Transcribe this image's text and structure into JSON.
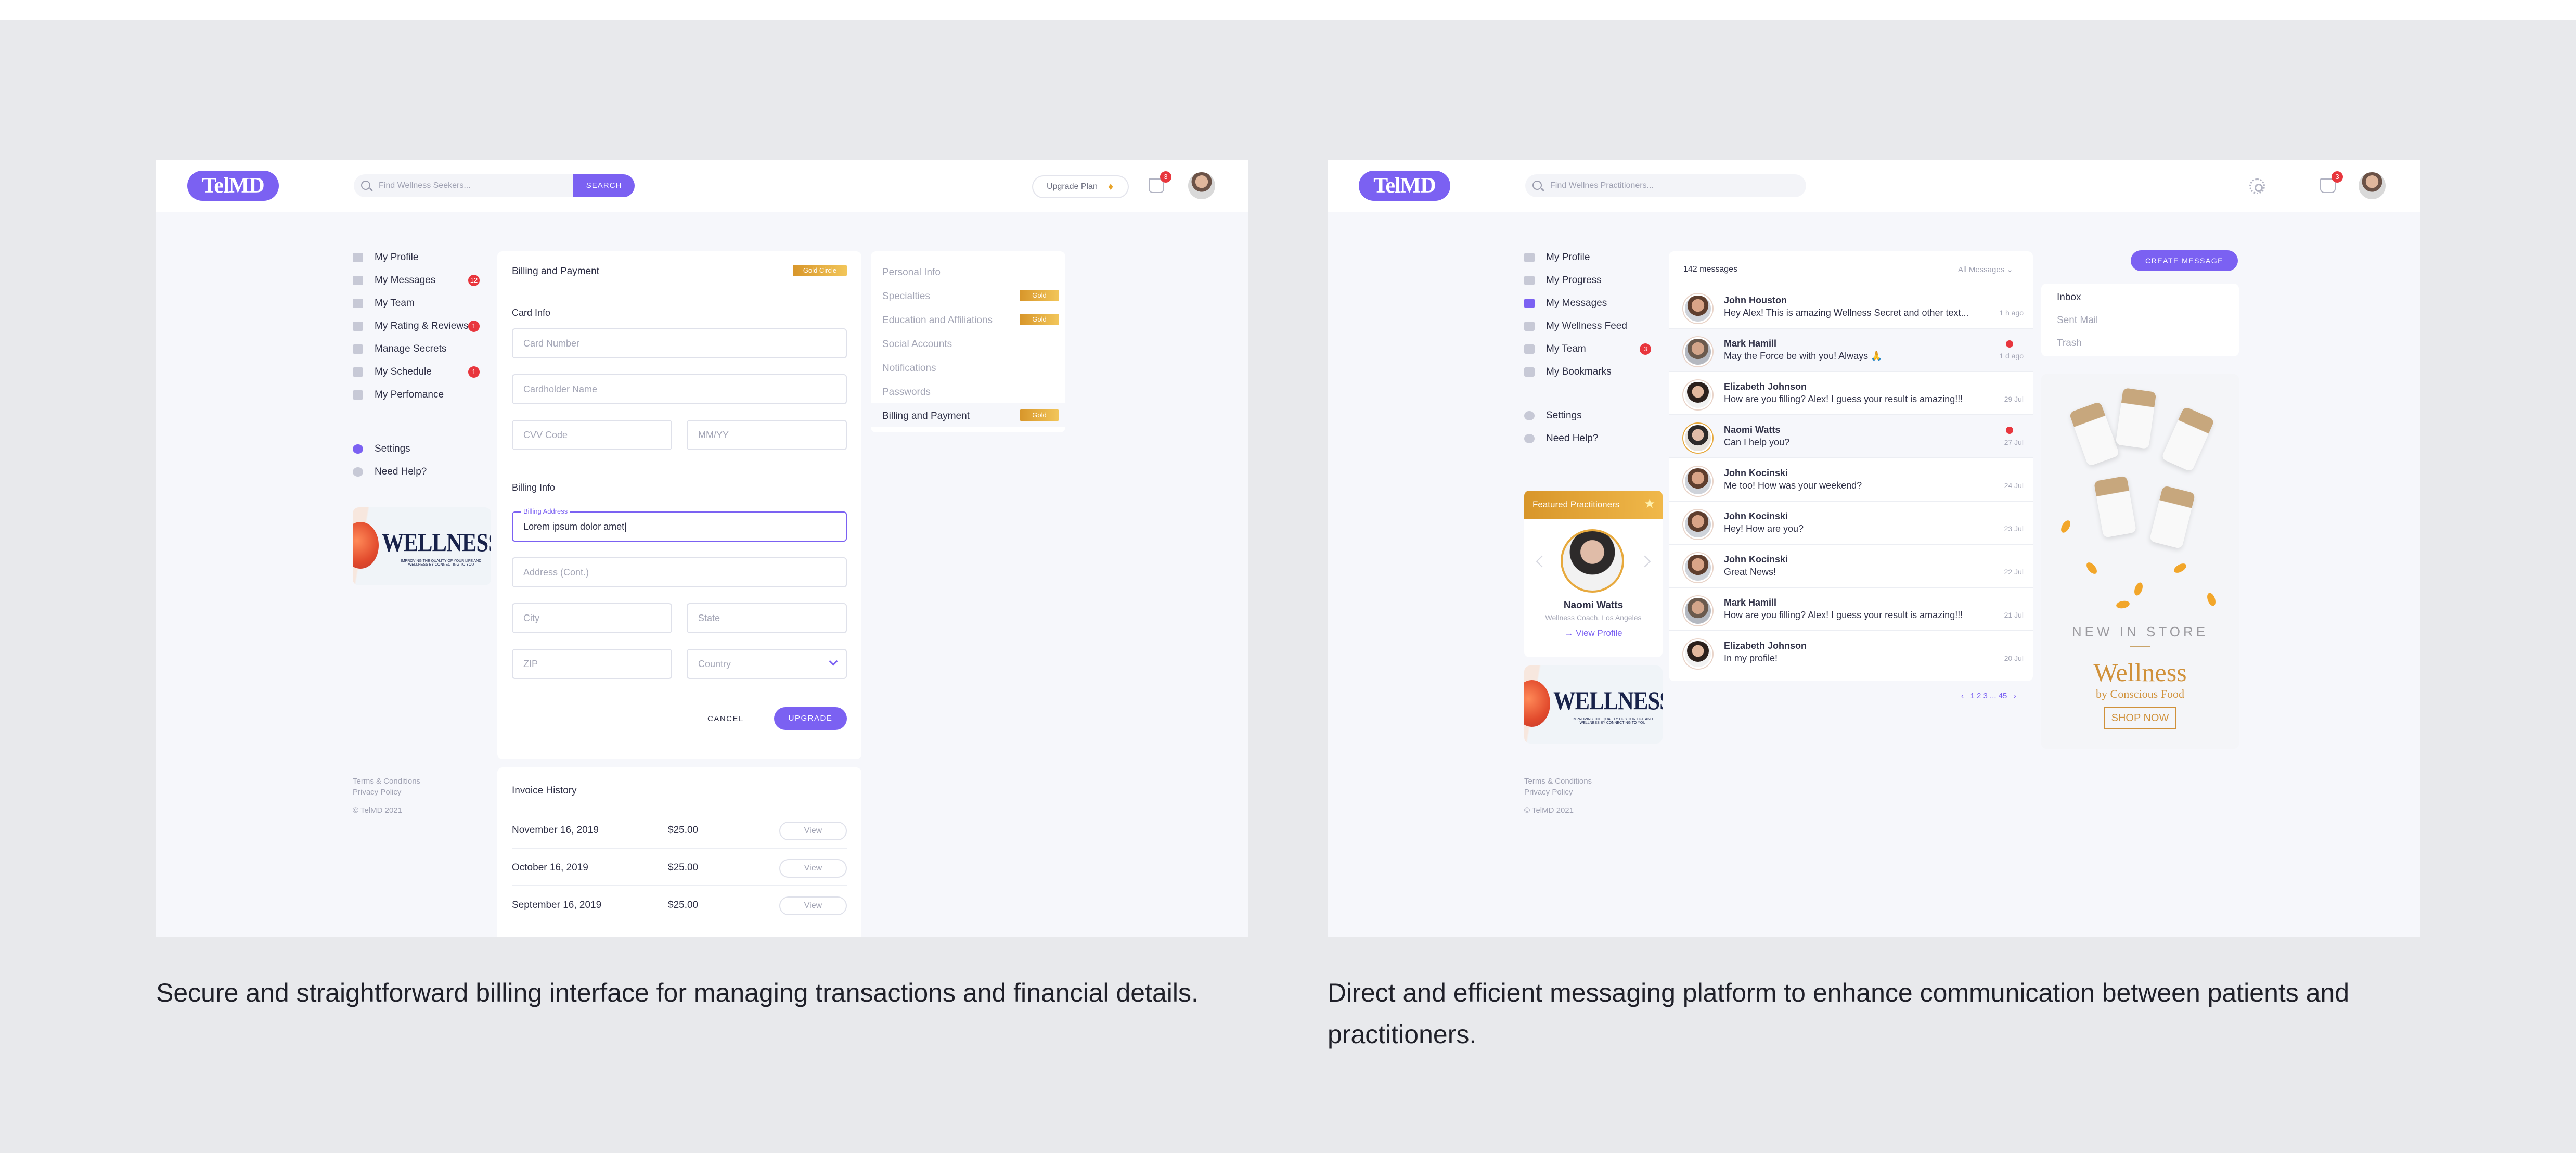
{
  "left_panel": {
    "logo": "TelMD",
    "search": {
      "placeholder": "Find Wellness Seekers...",
      "button": "SEARCH"
    },
    "upgrade_plan": "Upgrade Plan",
    "cart_badge": "3",
    "nav": [
      {
        "label": "My Profile",
        "icon": "user-icon"
      },
      {
        "label": "My Messages",
        "icon": "message-icon",
        "badge": "12"
      },
      {
        "label": "My Team",
        "icon": "team-icon"
      },
      {
        "label": "My Rating & Reviews",
        "icon": "bookmark-icon",
        "badge": "1"
      },
      {
        "label": "Manage Secrets",
        "icon": "lock-icon"
      },
      {
        "label": "My Schedule",
        "icon": "calendar-icon",
        "badge": "1"
      },
      {
        "label": "My Perfomance",
        "icon": "chart-icon"
      }
    ],
    "nav_secondary": [
      {
        "label": "Settings",
        "icon": "gear-icon"
      },
      {
        "label": "Need Help?",
        "icon": "help-icon"
      }
    ],
    "ad": {
      "title": "WELLNESS",
      "subtitle": "IMPROVING THE QUALITY OF YOUR LIFE AND WELLNESS BY CONNECTING TO YOU"
    },
    "footer": {
      "terms": "Terms & Conditions",
      "privacy": "Privacy Policy",
      "copyright": "© TelMD 2021"
    },
    "billing": {
      "title": "Billing and Payment",
      "plan_badge": "Gold Circle",
      "card_info": "Card Info",
      "card_number": "Card Number",
      "cardholder": "Cardholder Name",
      "cvv": "CVV Code",
      "expiry": "MM/YY",
      "billing_info": "Billing Info",
      "billing_address_label": "Billing Address",
      "billing_address_value": "Lorem ipsum dolor amet|",
      "address_cont": "Address (Cont.)",
      "city": "City",
      "state": "State",
      "zip": "ZIP",
      "country": "Country",
      "cancel": "CANCEL",
      "upgrade": "UPGRADE"
    },
    "invoice": {
      "title": "Invoice History",
      "rows": [
        {
          "date": "November 16, 2019",
          "amount": "$25.00",
          "action": "View"
        },
        {
          "date": "October 16, 2019",
          "amount": "$25.00",
          "action": "View"
        },
        {
          "date": "September 16, 2019",
          "amount": "$25.00",
          "action": "View"
        }
      ]
    },
    "settings_menu": [
      {
        "label": "Personal Info"
      },
      {
        "label": "Specialties",
        "tag": "Gold"
      },
      {
        "label": "Education and Affiliations",
        "tag": "Gold"
      },
      {
        "label": "Social Accounts"
      },
      {
        "label": "Notifications"
      },
      {
        "label": "Passwords"
      },
      {
        "label": "Billing and Payment",
        "tag": "Gold",
        "selected": true
      }
    ]
  },
  "right_panel": {
    "logo": "TelMD",
    "search": {
      "placeholder": "Find Wellnes Practitioners..."
    },
    "cart_badge": "3",
    "nav": [
      {
        "label": "My Profile",
        "icon": "user-icon"
      },
      {
        "label": "My Progress",
        "icon": "progress-icon"
      },
      {
        "label": "My Messages",
        "icon": "message-icon",
        "active": true
      },
      {
        "label": "My Wellness Feed",
        "icon": "feed-icon"
      },
      {
        "label": "My Team",
        "icon": "team-icon",
        "badge": "3"
      },
      {
        "label": "My Bookmarks",
        "icon": "bookmark-icon"
      }
    ],
    "nav_secondary": [
      {
        "label": "Settings",
        "icon": "gear-icon"
      },
      {
        "label": "Need Help?",
        "icon": "help-icon"
      }
    ],
    "featured": {
      "header": "Featured Practitioners",
      "name": "Naomi Watts",
      "role": "Wellness Coach, Los Angeles",
      "link": "View Profile"
    },
    "ad": {
      "title": "WELLNESS",
      "subtitle": "IMPROVING THE QUALITY OF YOUR LIFE AND WELLNESS BY CONNECTING TO YOU"
    },
    "footer": {
      "terms": "Terms & Conditions",
      "privacy": "Privacy Policy",
      "copyright": "© TelMD 2021"
    },
    "messages": {
      "count": "142 messages",
      "filter": "All Messages",
      "items": [
        {
          "name": "John Houston",
          "text": "Hey Alex! This is amazing Wellness Secret and other text...",
          "time": "1 h ago"
        },
        {
          "name": "Mark Hamill",
          "text": "May the Force be with you! Always 🙏",
          "time": "1 d ago",
          "unread": true
        },
        {
          "name": "Elizabeth Johnson",
          "text": "How are you filling? Alex! I guess your result is amazing!!!",
          "time": "29 Jul"
        },
        {
          "name": "Naomi Watts",
          "text": "Can I help you?",
          "time": "27 Jul",
          "unread": true
        },
        {
          "name": "John Kocinski",
          "text": "Me too! How was your weekend?",
          "time": "24 Jul"
        },
        {
          "name": "John Kocinski",
          "text": "Hey! How are you?",
          "time": "23 Jul"
        },
        {
          "name": "John Kocinski",
          "text": "Great News!",
          "time": "22 Jul"
        },
        {
          "name": "Mark Hamill",
          "text": "How are you filling? Alex! I guess your result is amazing!!!",
          "time": "21 Jul"
        },
        {
          "name": "Elizabeth Johnson",
          "text": "In my profile!",
          "time": "20 Jul"
        }
      ],
      "pagination": "1 2 3 ... 45"
    },
    "create_message": "CREATE MESSAGE",
    "folders": [
      {
        "label": "Inbox",
        "selected": true
      },
      {
        "label": "Sent Mail"
      },
      {
        "label": "Trash"
      }
    ],
    "promo": {
      "tagline": "NEW IN STORE",
      "title": "Wellness",
      "subtitle": "by Conscious Food",
      "cta": "SHOP NOW"
    }
  },
  "captions": {
    "left": "Secure and straightforward billing interface for managing transactions and financial details.",
    "right": "Direct and efficient messaging platform to enhance communication between patients and practitioners."
  }
}
